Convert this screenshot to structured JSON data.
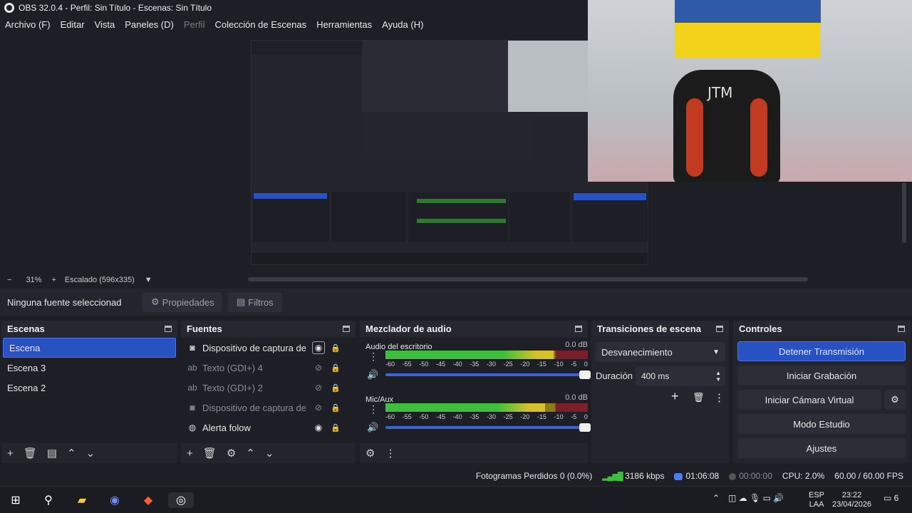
{
  "window": {
    "title": "OBS 32.0.4 - Perfil: Sin Título - Escenas: Sin Título"
  },
  "menu": [
    {
      "label": "Archivo (F)",
      "disabled": false
    },
    {
      "label": "Editar",
      "disabled": false
    },
    {
      "label": "Vista",
      "disabled": false
    },
    {
      "label": "Paneles (D)",
      "disabled": false
    },
    {
      "label": "Perfil",
      "disabled": true
    },
    {
      "label": "Colección de Escenas",
      "disabled": false
    },
    {
      "label": "Herramientas",
      "disabled": false
    },
    {
      "label": "Ayuda (H)",
      "disabled": false
    }
  ],
  "preview": {
    "webcam_text": "JTM",
    "zoom": "31%",
    "scale": "Escalado (596x335)"
  },
  "source_toolbar": {
    "no_source": "Ninguna fuente seleccionad",
    "properties": "Propiedades",
    "filters": "Filtros"
  },
  "scenes": {
    "title": "Escenas",
    "items": [
      {
        "label": "Escena",
        "selected": true
      },
      {
        "label": "Escena 3",
        "selected": false
      },
      {
        "label": "Escena 2",
        "selected": false
      }
    ]
  },
  "sources": {
    "title": "Fuentes",
    "items": [
      {
        "label": "Dispositivo de captura de v",
        "icon": "camera-icon",
        "visible": true
      },
      {
        "label": "Texto (GDI+) 4",
        "icon": "text-icon",
        "visible": false
      },
      {
        "label": "Texto (GDI+) 2",
        "icon": "text-icon",
        "visible": false
      },
      {
        "label": "Dispositivo de captura de v",
        "icon": "camera-icon",
        "visible": false
      },
      {
        "label": "Alerta folow",
        "icon": "browser-icon",
        "visible": true
      }
    ]
  },
  "mixer": {
    "title": "Mezclador de audio",
    "ticks": [
      "-60",
      "-55",
      "-50",
      "-45",
      "-40",
      "-35",
      "-30",
      "-25",
      "-20",
      "-15",
      "-10",
      "-5",
      "0"
    ],
    "channels": [
      {
        "name": "Audio del escritorio",
        "db": "0.0 dB",
        "level": 0.83
      },
      {
        "name": "Mic/Aux",
        "db": "0.0 dB",
        "level": 0.79
      }
    ]
  },
  "transitions": {
    "title": "Transiciones de escena",
    "selected": "Desvanecimiento",
    "duration_label": "Duración",
    "duration_value": "400 ms"
  },
  "controls": {
    "title": "Controles",
    "stop_stream": "Detener Transmisión",
    "start_recording": "Iniciar Grabación",
    "start_virtual_cam": "Iniciar Cámara Virtual",
    "studio_mode": "Modo Estudio",
    "settings": "Ajustes"
  },
  "status": {
    "dropped": "Fotogramas Perdidos 0 (0.0%)",
    "bitrate": "3186 kbps",
    "stream_time": "01:06:08",
    "rec_time": "00:00:00",
    "cpu": "CPU: 2.0%",
    "fps": "60.00 / 60.00 FPS"
  },
  "taskbar": {
    "lang1": "ESP",
    "lang2": "LAA",
    "time": "23:22",
    "date": "23/04/2026",
    "notif": "6"
  },
  "colors": {
    "accent": "#2851c4",
    "bg": "#1e1f26",
    "panel": "#23242c",
    "meter_green": "#3dbf3d"
  }
}
